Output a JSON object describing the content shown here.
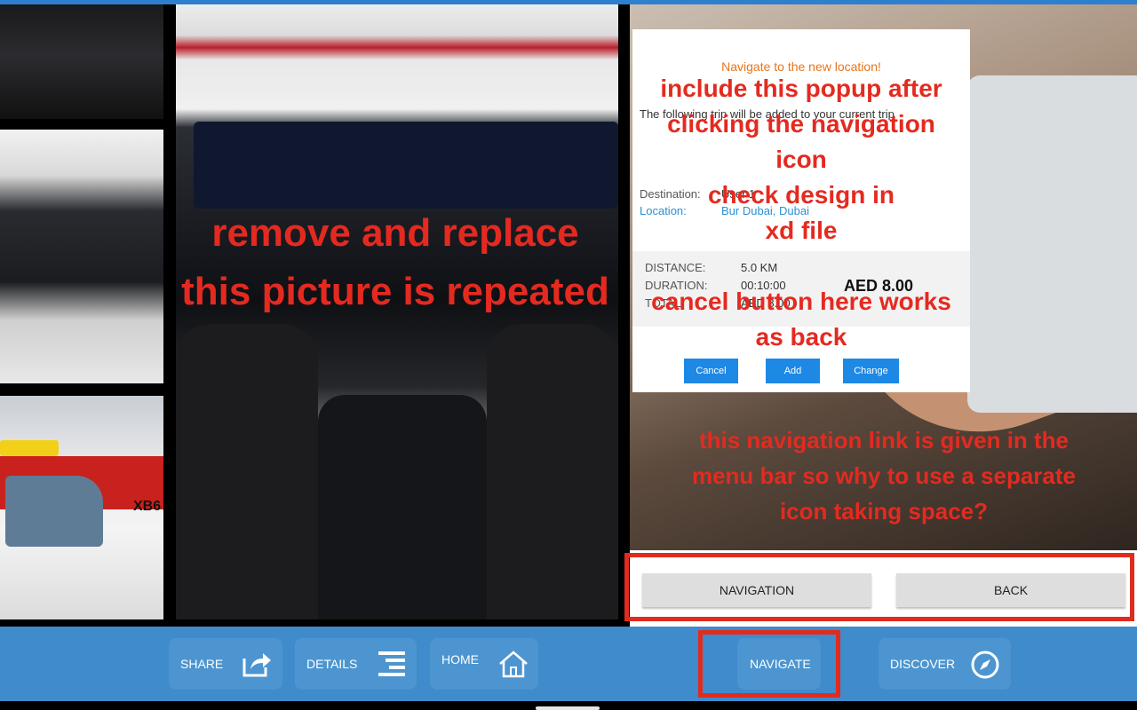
{
  "popup": {
    "title": "Navigate to the new location!",
    "message": "The following trip will be added to your current trip",
    "destination_label": "Destination:",
    "destination_value": "User 1",
    "location_label": "Location:",
    "location_value": "Bur Dubai, Dubai",
    "distance_label": "DISTANCE:",
    "distance_value": "5.0 KM",
    "duration_label": "DURATION:",
    "duration_value": "00:10:00",
    "total_label": "TOTAL:",
    "total_value": "AED 8.00",
    "price": "AED 8.00",
    "buttons": {
      "cancel": "Cancel",
      "add": "Add",
      "change": "Change"
    }
  },
  "annotations": {
    "popup_note": [
      "include this popup after",
      "clicking the navigation",
      "icon",
      "check design in",
      "xd file"
    ],
    "image_note": [
      "remove and replace",
      "this picture is repeated"
    ],
    "cancel_note": [
      "cancel button here works",
      "as back"
    ],
    "nav_note": [
      "this navigation link is given in the",
      "menu bar so why to use a separate",
      "icon taking space?"
    ]
  },
  "action_bar": {
    "navigation": "NAVIGATION",
    "back": "BACK"
  },
  "bottom_nav": {
    "share": "SHARE",
    "details": "DETAILS",
    "home": "HOME",
    "navigate": "NAVIGATE",
    "discover": "DISCOVER"
  },
  "taxi_plate": "XB6",
  "colors": {
    "accent_blue": "#3f8bcb",
    "popup_title": "#e8741c",
    "popup_button": "#1e88e5",
    "annotation_red": "#e42a20"
  }
}
